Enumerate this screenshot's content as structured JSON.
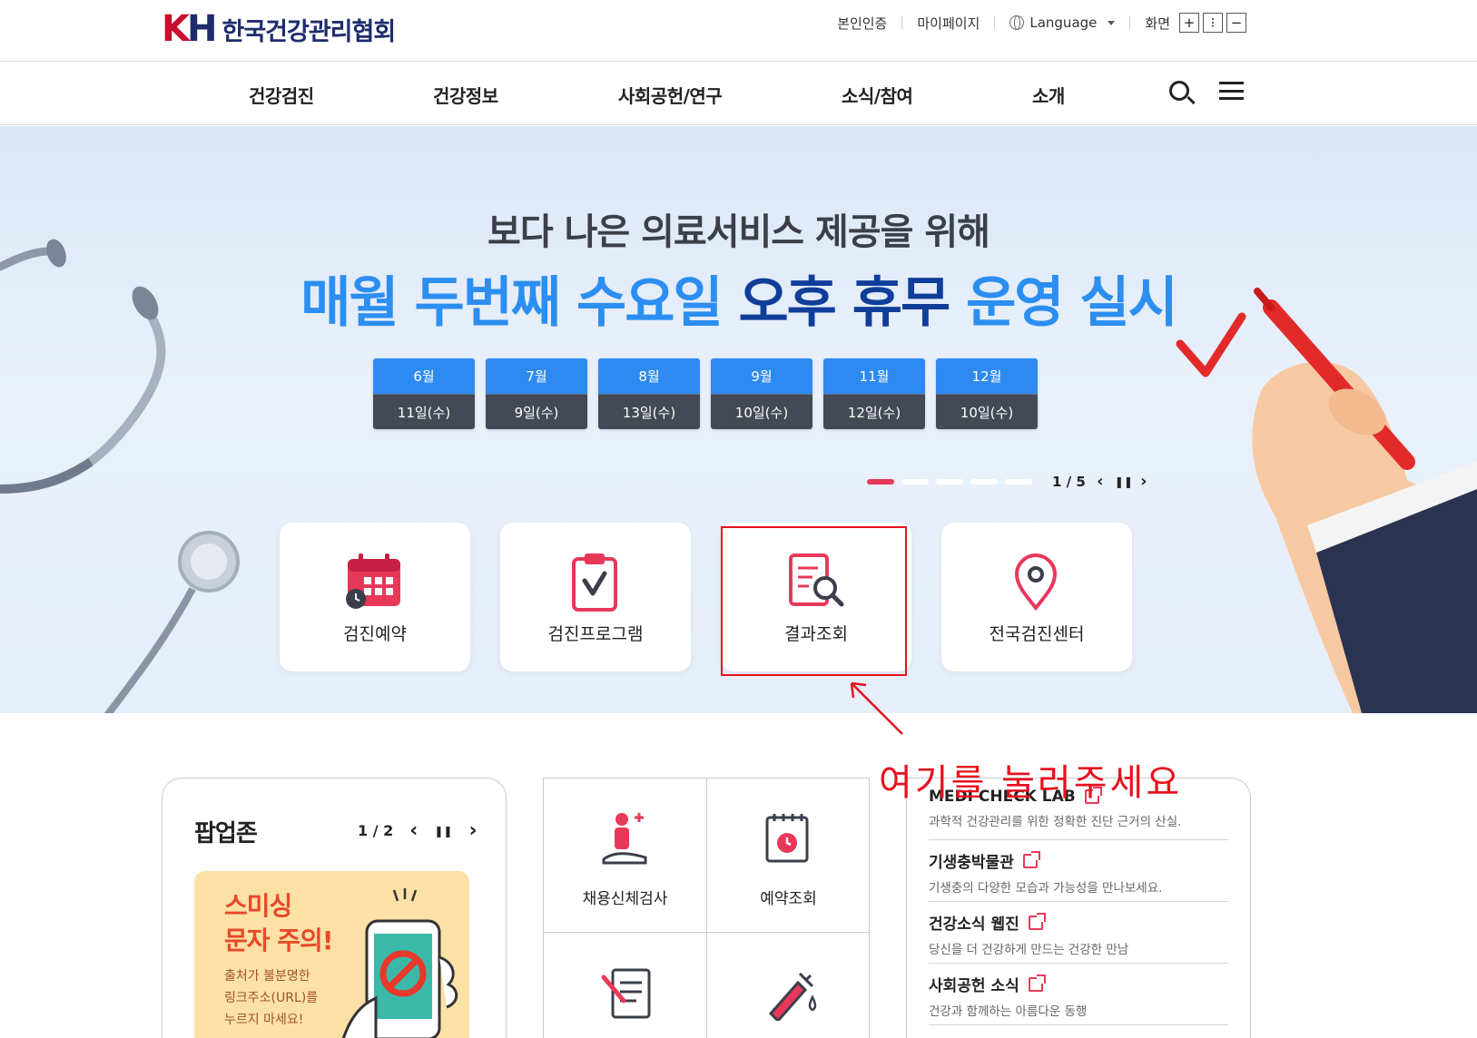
{
  "header": {
    "logo_mark": "KH",
    "logo_text": "한국건강관리협회",
    "utils": {
      "verify": "본인인증",
      "mypage": "마이페이지",
      "language": "Language",
      "screen": "화면",
      "zoom_in": "+",
      "zoom_reset": "⁝",
      "zoom_out": "−"
    }
  },
  "nav": {
    "items": [
      "건강검진",
      "건강정보",
      "사회공헌/연구",
      "소식/참여",
      "소개"
    ]
  },
  "hero": {
    "subtitle": "보다 나은 의료서비스 제공을 위해",
    "title_part1": "매월 두번째 수요일 ",
    "title_part2": "오후 휴무",
    "title_part3": " 운영 실시",
    "dates": [
      {
        "month": "6월",
        "day": "11일(수)"
      },
      {
        "month": "7월",
        "day": "9일(수)"
      },
      {
        "month": "8월",
        "day": "13일(수)"
      },
      {
        "month": "9월",
        "day": "10일(수)"
      },
      {
        "month": "11월",
        "day": "12일(수)"
      },
      {
        "month": "12월",
        "day": "10일(수)"
      }
    ],
    "pager": {
      "count": "1 / 5",
      "prev": "‹",
      "pause": "❚❚",
      "next": "›",
      "current": 1,
      "total": 5
    }
  },
  "quick_menu": [
    {
      "label": "검진예약",
      "icon": "calendar-icon"
    },
    {
      "label": "검진프로그램",
      "icon": "clipboard-check-icon"
    },
    {
      "label": "결과조회",
      "icon": "document-search-icon"
    },
    {
      "label": "전국검진센터",
      "icon": "location-pin-icon"
    }
  ],
  "annotation": {
    "text": "여기를 눌러주세요",
    "color": "#e8101e"
  },
  "popup_zone": {
    "title": "팝업존",
    "count": "1 / 2",
    "prev": "‹",
    "pause": "❚❚",
    "next": "›",
    "banner": {
      "title_line1": "스미싱",
      "title_line2": "문자 주의!",
      "desc_line1": "출처가 불분명한",
      "desc_line2": "링크주소(URL)를",
      "desc_line3": "누르지 마세요!"
    }
  },
  "services": [
    {
      "label": "채용신체검사",
      "icon": "person-health-icon"
    },
    {
      "label": "예약조회",
      "icon": "calendar-clock-icon"
    },
    {
      "label": "",
      "icon": "document-pen-icon"
    },
    {
      "label": "",
      "icon": "syringe-icon"
    }
  ],
  "links": [
    {
      "title": "MEDI CHECK LAB",
      "desc": "과학적 건강관리를 위한 정확한 진단 근거의 산실."
    },
    {
      "title": "기생충박물관",
      "desc": "기생충의 다양한 모습과 가능성을 만나보세요."
    },
    {
      "title": "건강소식 웹진",
      "desc": "당신을 더 건강하게 만드는 건강한 만남"
    },
    {
      "title": "사회공헌 소식",
      "desc": "건강과 함께하는 아름다운 동행"
    }
  ],
  "colors": {
    "brand_red": "#c8102e",
    "brand_navy": "#1e2c6e",
    "hero_blue": "#2b8ef0",
    "hero_navy": "#0f3e9a",
    "accent_pink": "#e8385a"
  }
}
